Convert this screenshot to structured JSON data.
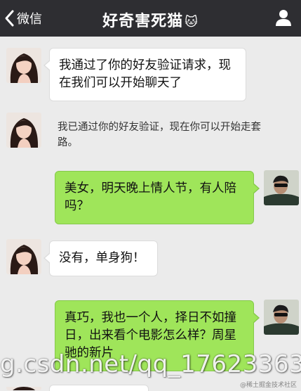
{
  "header": {
    "back_label": "微信",
    "title": "好奇害死猫",
    "title_emoji": "🐱"
  },
  "messages": [
    {
      "from": "contact",
      "text": "我通过了你的好友验证请求，现在我们可以开始聊天了"
    },
    {
      "from": "contact",
      "text": "我已通过你的好友验证，现在你可以开始走套路。"
    },
    {
      "from": "me",
      "text": "美女，明天晚上情人节，有人陪吗？"
    },
    {
      "from": "contact",
      "text": "没有，单身狗！"
    },
    {
      "from": "me",
      "text": "真巧，我也一个人，择日不如撞日，出来看个电影怎么样？周星驰的新片"
    }
  ],
  "watermark": "g.csdn.net/qq_17623363",
  "corner_mark": "@稀土掘金技术社区",
  "colors": {
    "header_bg": "#2e2e32",
    "chat_bg": "#ebebeb",
    "my_bubble": "#9fe55a",
    "their_bubble": "#ffffff"
  }
}
